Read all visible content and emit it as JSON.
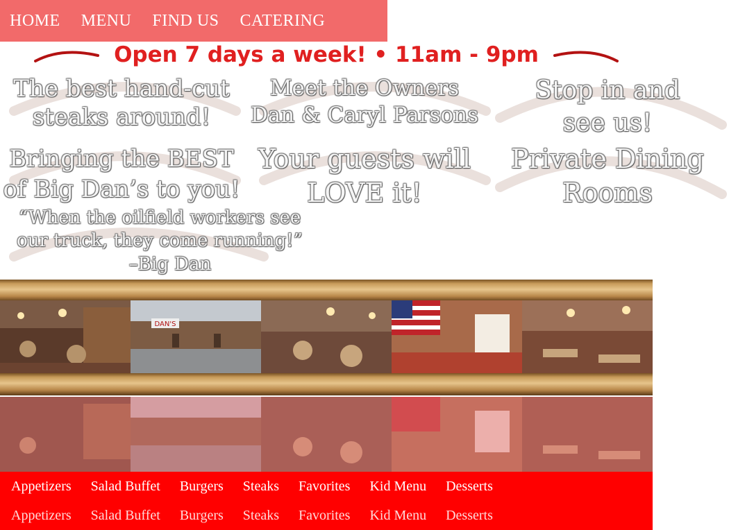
{
  "topnav": {
    "items": [
      "HOME",
      "MENU",
      "FIND US",
      "CATERING"
    ]
  },
  "hours": {
    "text": "Open 7 days a week! • 11am - 9pm"
  },
  "promos": {
    "steaks": {
      "line1": "The best hand-cut",
      "line2": "steaks around!"
    },
    "owners": {
      "line1": "Meet the Owners",
      "line2": "Dan & Caryl Parsons"
    },
    "stop": {
      "line1": "Stop in and",
      "line2": "see us!"
    },
    "best": {
      "line1": "Bringing the BEST",
      "line2": "of Big Dan’s to you!"
    },
    "guests": {
      "line1": "Your guests will",
      "line2": "LOVE it!"
    },
    "private": {
      "line1": "Private Dining",
      "line2": "Rooms"
    },
    "quote": {
      "line1": "“When the oilfield workers see",
      "line2": "our truck, they come running!”",
      "line3": "–Big Dan"
    }
  },
  "gallery": {
    "sign_text": "DAN'S"
  },
  "categories": [
    "Appetizers",
    "Salad Buffet",
    "Burgers",
    "Steaks",
    "Favorites",
    "Kid Menu",
    "Desserts"
  ],
  "colors": {
    "accent_red": "#ff0000",
    "nav_pink": "#f26a6a",
    "hours_red": "#e02020"
  }
}
